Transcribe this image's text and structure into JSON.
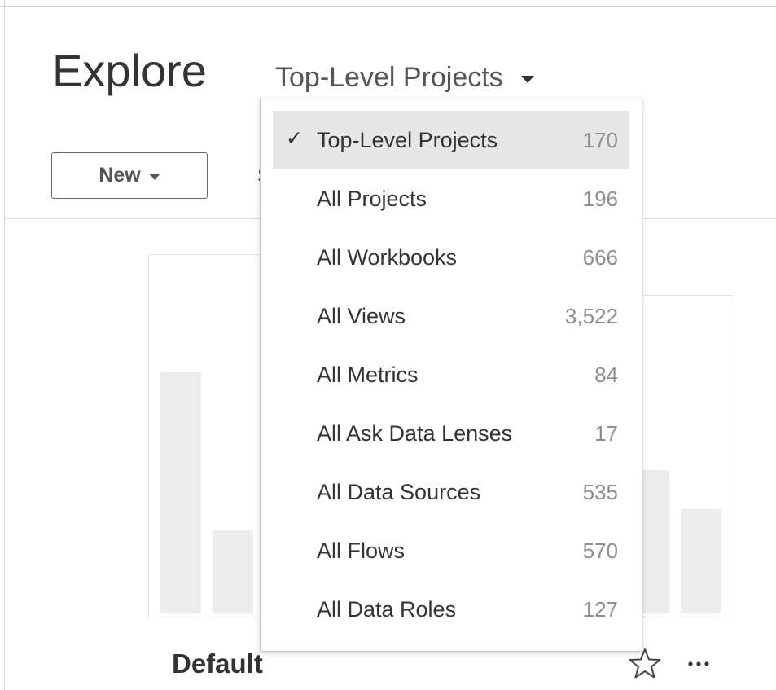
{
  "header": {
    "title": "Explore",
    "content_selector": "Top-Level Projects"
  },
  "toolbar": {
    "new_label": "New",
    "partial_label": "S"
  },
  "dropdown": {
    "items": [
      {
        "label": "Top-Level Projects",
        "count": "170",
        "selected": true
      },
      {
        "label": "All Projects",
        "count": "196",
        "selected": false
      },
      {
        "label": "All Workbooks",
        "count": "666",
        "selected": false
      },
      {
        "label": "All Views",
        "count": "3,522",
        "selected": false
      },
      {
        "label": "All Metrics",
        "count": "84",
        "selected": false
      },
      {
        "label": "All Ask Data Lenses",
        "count": "17",
        "selected": false
      },
      {
        "label": "All Data Sources",
        "count": "535",
        "selected": false
      },
      {
        "label": "All Flows",
        "count": "570",
        "selected": false
      },
      {
        "label": "All Data Roles",
        "count": "127",
        "selected": false
      }
    ],
    "check_glyph": "✓"
  },
  "project_card": {
    "name": "Default",
    "favorite_icon": "star-outline-icon",
    "more_icon": "more-horizontal-icon"
  },
  "colors": {
    "selected_bg": "#e6e6e6",
    "count_text": "#8f8f8f",
    "thumbnail_bar": "#ececec"
  }
}
